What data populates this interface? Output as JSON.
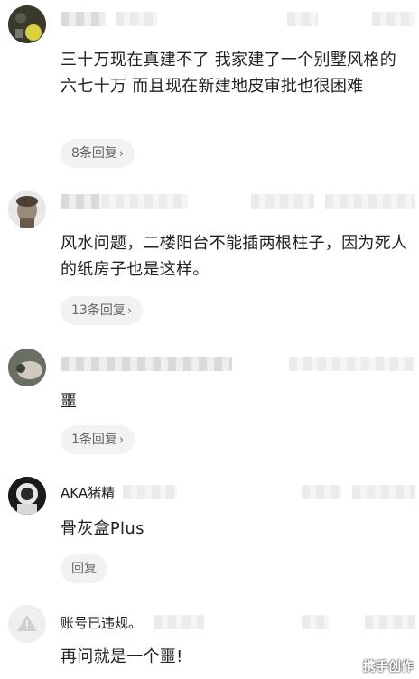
{
  "comments": [
    {
      "name": "",
      "text": "三十万现在真建不了 我家建了一个别墅风格的 六七十万 而且现在新建地皮审批也很困难",
      "reply_label": "8条回复",
      "chevron": "›"
    },
    {
      "name": "",
      "text": "风水问题，二楼阳台不能插两根柱子，因为死人的纸房子也是这样。",
      "reply_label": "13条回复",
      "chevron": "›"
    },
    {
      "name": "",
      "text": "噩",
      "reply_label": "1条回复",
      "chevron": "›"
    },
    {
      "name": "AKA猪精",
      "text": "骨灰盒Plus",
      "reply_label": "回复",
      "chevron": ""
    },
    {
      "name": "账号已违规。",
      "text": "再问就是一个噩!",
      "reply_label": "",
      "chevron": ""
    }
  ],
  "watermark": "携手创作",
  "icons": {
    "violation_avatar": "warning-triangle-icon",
    "chevron": "chevron-right-icon"
  }
}
